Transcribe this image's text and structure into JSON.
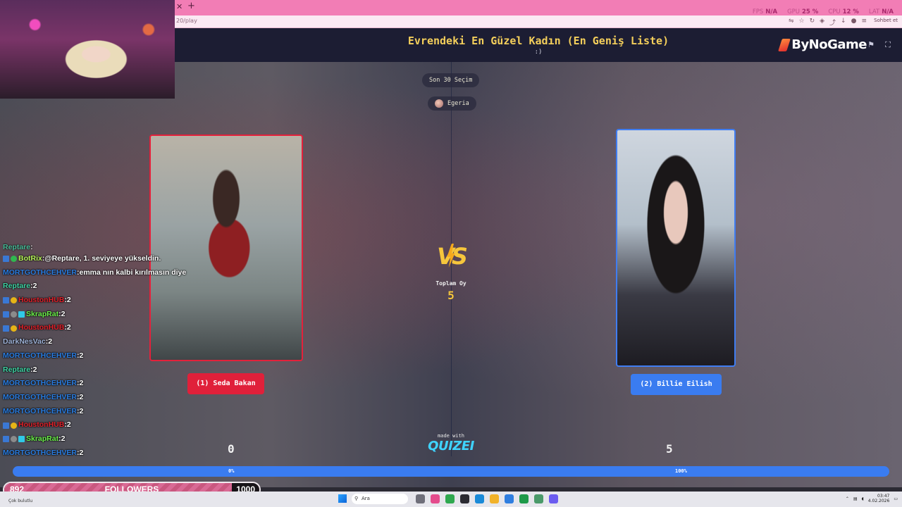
{
  "browser": {
    "url": "20/play",
    "stats": [
      {
        "label": "FPS",
        "value": "N/A"
      },
      {
        "label": "GPU",
        "value": "25 %"
      },
      {
        "label": "CPU",
        "value": "12 %"
      },
      {
        "label": "LAT",
        "value": "N/A"
      }
    ],
    "chat_button": "Sohbet et"
  },
  "game": {
    "title": "Evrendeki En Güzel Kadın (En Geniş Liste)",
    "subtitle": ":)",
    "brand": "ByNoGame",
    "recent_pill": "Son 30 Seçim",
    "user_pill": "Egeria",
    "left": {
      "choice_label": "(1) Seda Bakan",
      "score": "0",
      "percent": "0%",
      "percent_value": 0
    },
    "right": {
      "choice_label": "(2) Billie Eilish",
      "score": "5",
      "percent": "100%",
      "percent_value": 100
    },
    "total_label": "Toplam Oy",
    "total_value": "5",
    "made_with": "made with",
    "quizei": "QUIZEI",
    "colors": {
      "left": "#e0203a",
      "right": "#3a7cf0",
      "accent": "#f4cf5b"
    }
  },
  "chat": [
    {
      "user": "Reptare",
      "message": "",
      "user_color": "#3fd3a4",
      "badges": [],
      "cut": true
    },
    {
      "user": "BotRix",
      "message": "@Reptare, 1. seviyeye yükseldin.",
      "user_color": "#b7f55a",
      "badges": [
        "prime",
        "green"
      ]
    },
    {
      "user": "MORTGOTHCEHVER",
      "message": "emma nın kalbi kırılmasın diye",
      "user_color": "#2a7de1",
      "badges": []
    },
    {
      "user": "Reptare",
      "message": "2",
      "user_color": "#3fd3a4",
      "badges": []
    },
    {
      "user": "HoustonHUB",
      "message": "2",
      "user_color": "#e0202a",
      "badges": [
        "prime",
        "gold"
      ]
    },
    {
      "user": "SkrapRat",
      "message": "2",
      "user_color": "#6bf04a",
      "badges": [
        "prime",
        "mod",
        "sub"
      ]
    },
    {
      "user": "HoustonHUB",
      "message": "2",
      "user_color": "#e0202a",
      "badges": [
        "prime",
        "gold"
      ]
    },
    {
      "user": "DarkNesVac",
      "message": "2",
      "user_color": "#9fb3d8",
      "badges": []
    },
    {
      "user": "MORTGOTHCEHVER",
      "message": "2",
      "user_color": "#2a7de1",
      "badges": []
    },
    {
      "user": "Reptare",
      "message": "2",
      "user_color": "#3fd3a4",
      "badges": []
    },
    {
      "user": "MORTGOTHCEHVER",
      "message": "2",
      "user_color": "#2a7de1",
      "badges": []
    },
    {
      "user": "MORTGOTHCEHVER",
      "message": "2",
      "user_color": "#2a7de1",
      "badges": []
    },
    {
      "user": "MORTGOTHCEHVER",
      "message": "2",
      "user_color": "#2a7de1",
      "badges": []
    },
    {
      "user": "HoustonHUB",
      "message": "2",
      "user_color": "#e0202a",
      "badges": [
        "prime",
        "gold"
      ]
    },
    {
      "user": "SkrapRat",
      "message": "2",
      "user_color": "#6bf04a",
      "badges": [
        "prime",
        "mod",
        "sub"
      ]
    },
    {
      "user": "MORTGOTHCEHVER",
      "message": "2",
      "user_color": "#2a7de1",
      "badges": []
    }
  ],
  "followers": {
    "current": "892",
    "label": "FOLLOWERS",
    "goal": "1000",
    "progress": 0.892
  },
  "taskbar": {
    "weather": "Çok bulutlu",
    "search_placeholder": "Ara",
    "time": "03:47",
    "date": "4.02.2026"
  }
}
